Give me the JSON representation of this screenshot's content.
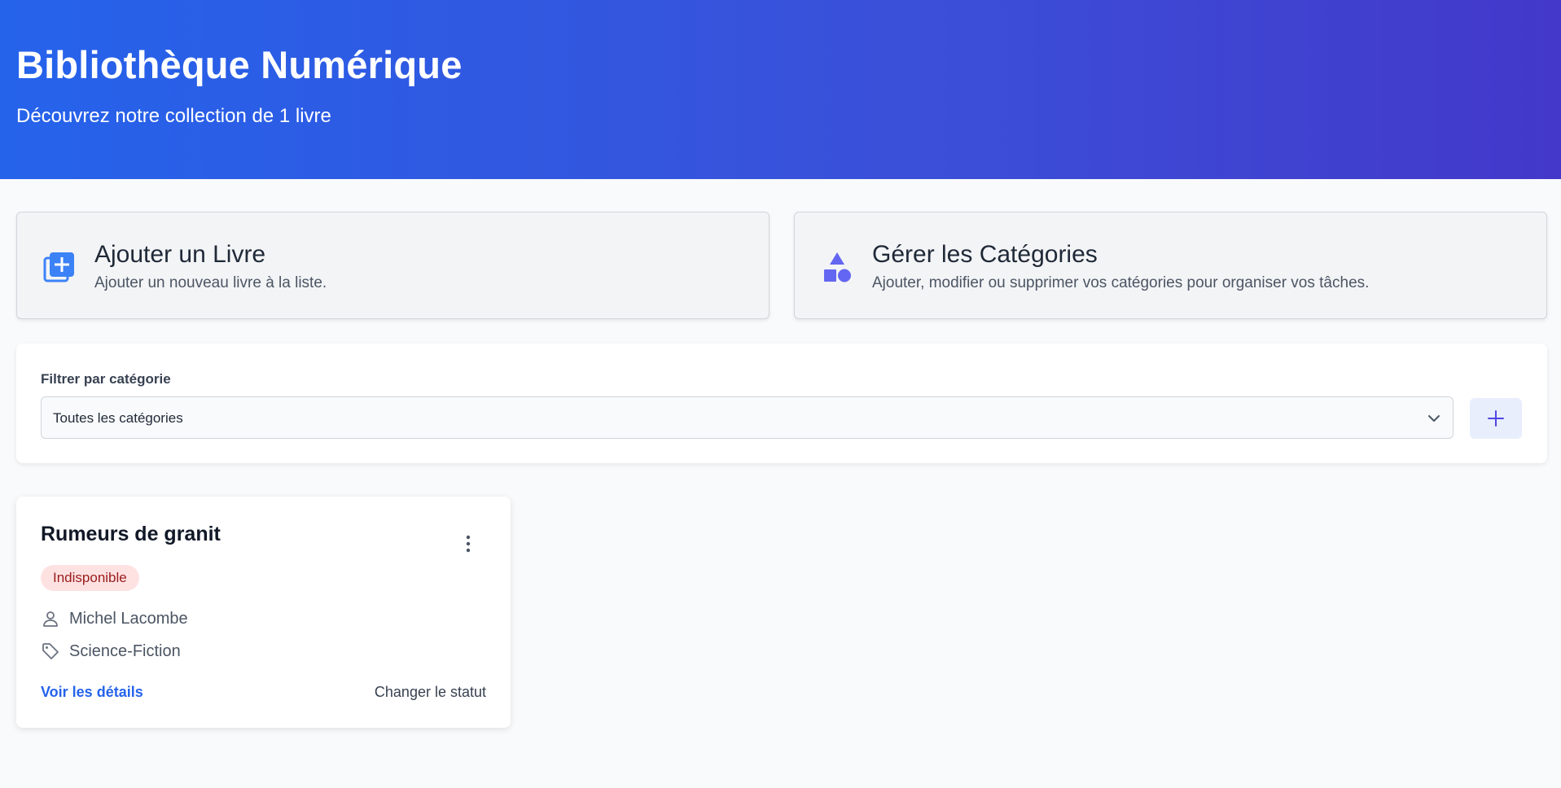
{
  "header": {
    "title": "Bibliothèque Numérique",
    "subtitle": "Découvrez notre collection de 1 livre"
  },
  "actions": {
    "add_book": {
      "title": "Ajouter un Livre",
      "description": "Ajouter un nouveau livre à la liste.",
      "icon": "library-add-icon"
    },
    "manage_categories": {
      "title": "Gérer les Catégories",
      "description": "Ajouter, modifier ou supprimer vos catégories pour organiser vos tâches.",
      "icon": "category-shapes-icon"
    }
  },
  "filter": {
    "label": "Filtrer par catégorie",
    "selected": "Toutes les catégories",
    "add_icon": "plus-icon"
  },
  "books": [
    {
      "title": "Rumeurs de granit",
      "status": "Indisponible",
      "author": "Michel Lacombe",
      "category": "Science-Fiction",
      "details_label": "Voir les détails",
      "change_status_label": "Changer le statut"
    }
  ],
  "colors": {
    "hero_gradient_start": "#2563eb",
    "hero_gradient_end": "#4338ca",
    "accent": "#3b82f6",
    "category_icon": "#6366f1",
    "status_unavailable_bg": "#fee2e2",
    "status_unavailable_text": "#991b1b",
    "link": "#2563eb"
  }
}
